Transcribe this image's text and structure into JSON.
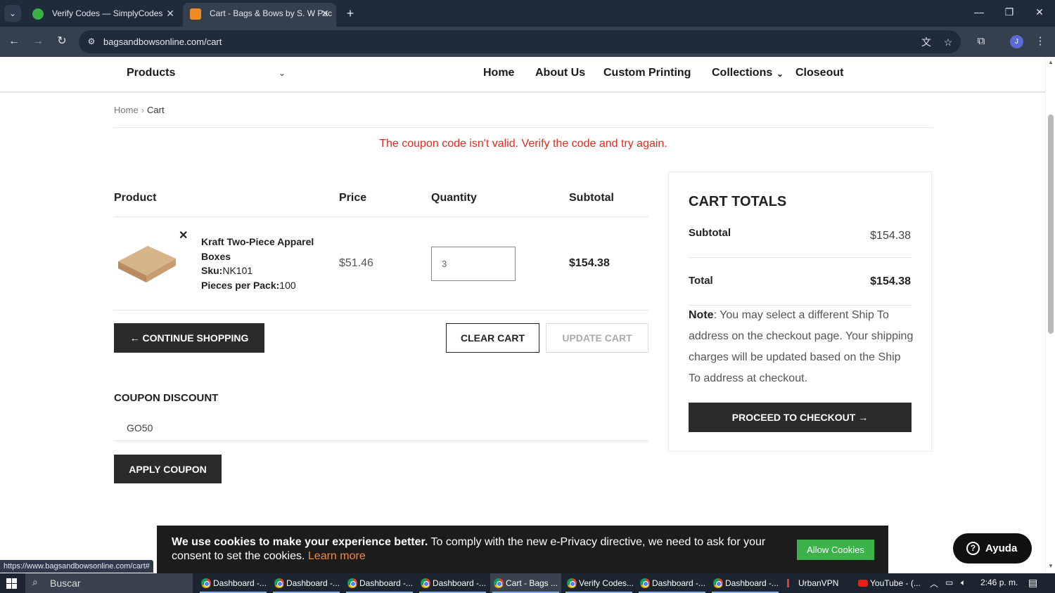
{
  "browser": {
    "tabs": [
      {
        "title": "Verify Codes — SimplyCodes",
        "active": false,
        "favicon_color": "#3cb043"
      },
      {
        "title": "Cart - Bags & Bows by S. W Pac",
        "active": true,
        "favicon_color": "#f08a24"
      }
    ],
    "url": "bagsandbowsonline.com/cart",
    "profile_initial": "J",
    "status_url": "https://www.bagsandbowsonline.com/cart#"
  },
  "nav": {
    "products_label": "Products",
    "links": [
      "Home",
      "About Us",
      "Custom Printing",
      "Collections",
      "Closeout"
    ]
  },
  "breadcrumb": {
    "home": "Home",
    "current": "Cart"
  },
  "error_message": "The coupon code isn't valid. Verify the code and try again.",
  "cart_table": {
    "headers": {
      "product": "Product",
      "price": "Price",
      "quantity": "Quantity",
      "subtotal": "Subtotal"
    },
    "item": {
      "name": "Kraft Two-Piece Apparel Boxes",
      "sku_label": "Sku:",
      "sku": "NK101",
      "pieces_label": "Pieces per Pack:",
      "pieces": "100",
      "price": "$51.46",
      "quantity": "3",
      "subtotal": "$154.38"
    }
  },
  "buttons": {
    "continue_shopping": "CONTINUE SHOPPING",
    "clear_cart": "CLEAR CART",
    "update_cart": "UPDATE CART",
    "apply_coupon": "APPLY COUPON",
    "proceed_checkout": "PROCEED TO CHECKOUT"
  },
  "coupon": {
    "title": "COUPON DISCOUNT",
    "value": "GO50"
  },
  "totals": {
    "title": "CART TOTALS",
    "subtotal_label": "Subtotal",
    "subtotal": "$154.38",
    "total_label": "Total",
    "total": "$154.38",
    "note_label": "Note",
    "note_text": ": You may select a different Ship To address on the checkout page. Your shipping charges will be updated based on the Ship To address at checkout."
  },
  "cookie": {
    "bold": "We use cookies to make your experience better.",
    "text": " To comply with the new e-Privacy directive, we need to ask for your consent to set the cookies. ",
    "link": "Learn more",
    "button": "Allow Cookies"
  },
  "help_button": "Ayuda",
  "taskbar": {
    "search": "Buscar",
    "items": [
      "Dashboard -...",
      "Dashboard -...",
      "Dashboard -...",
      "Dashboard -...",
      "Cart - Bags ...",
      "Verify Codes...",
      "Dashboard -...",
      "Dashboard -...",
      "UrbanVPN",
      "YouTube - (..."
    ],
    "time": "2:46 p. m."
  },
  "colors": {
    "error": "#e02b20",
    "dark_button": "#2b2b2b",
    "cookie_link": "#f58a3b",
    "cookie_button": "#3bb34a"
  }
}
